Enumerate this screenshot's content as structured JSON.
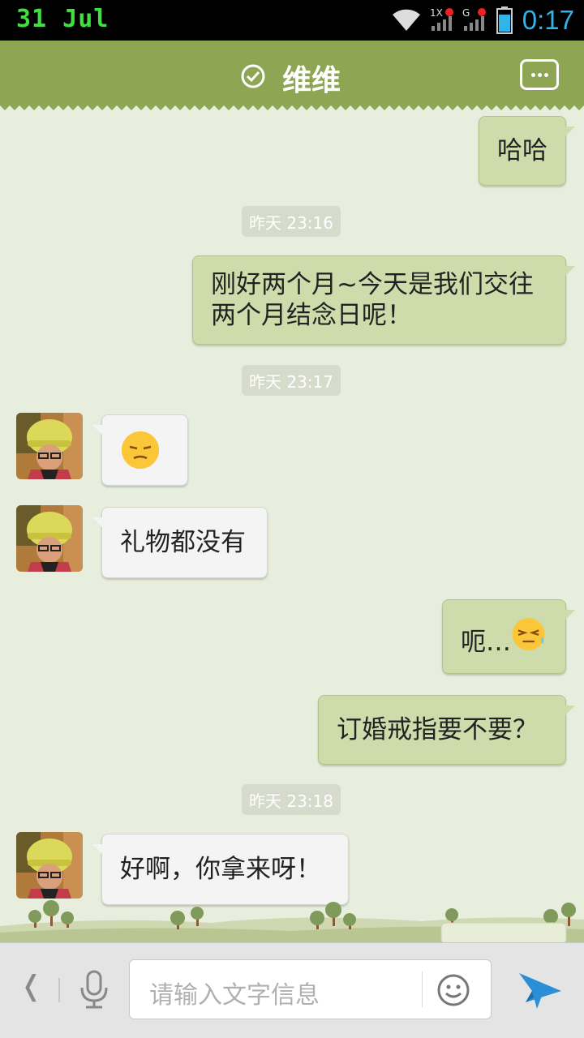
{
  "status_bar": {
    "date": "31 Jul",
    "time": "0:17",
    "network_1": "1X",
    "network_2": "G"
  },
  "header": {
    "contact_name": "维维"
  },
  "messages": [
    {
      "type": "out",
      "text": "哈哈"
    },
    {
      "type": "timestamp",
      "text": "昨天 23:16"
    },
    {
      "type": "out",
      "line1": "刚好两个月~今天是我们交往",
      "line2": "两个月结念日呢！"
    },
    {
      "type": "timestamp",
      "text": "昨天 23:17"
    },
    {
      "type": "in",
      "emoji": "frustrated-face"
    },
    {
      "type": "in",
      "text": "礼物都没有"
    },
    {
      "type": "out",
      "text": "呃…",
      "emoji": "sweat-face"
    },
    {
      "type": "out",
      "text": "订婚戒指要不要？"
    },
    {
      "type": "timestamp",
      "text": "昨天 23:18"
    },
    {
      "type": "in",
      "text": "好啊，你拿来呀！"
    }
  ],
  "input_bar": {
    "placeholder": "请输入文字信息"
  },
  "colors": {
    "header": "#8ea654",
    "background": "#e8eedd",
    "outgoing_bubble": "#cddcaa",
    "incoming_bubble": "#f4f4f4",
    "send_icon": "#2a8fd6"
  }
}
